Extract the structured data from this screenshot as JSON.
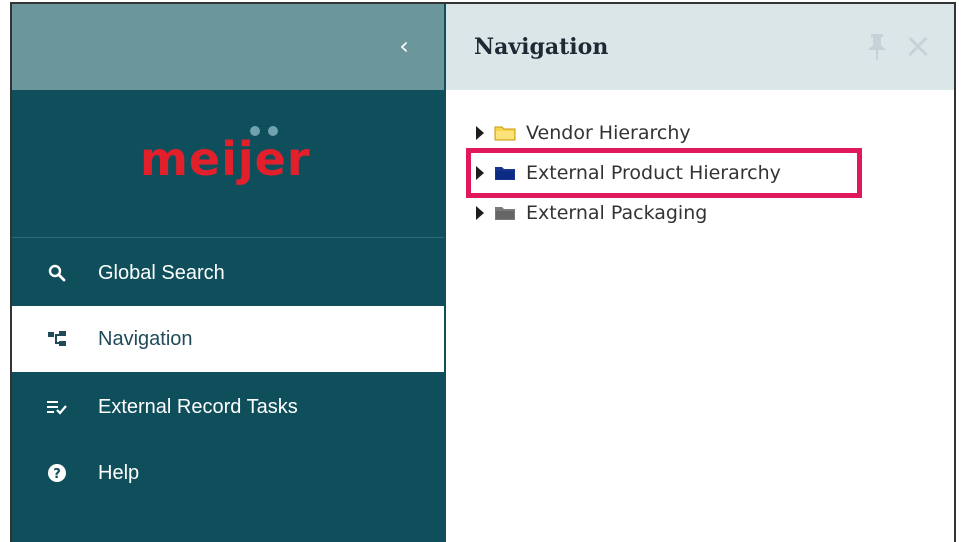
{
  "sidebar": {
    "collapse_glyph": "‹",
    "logo_text": "meijer",
    "items": [
      {
        "label": "Global Search",
        "icon": "search-icon"
      },
      {
        "label": "Navigation",
        "icon": "navigation-tree-icon",
        "active": true
      },
      {
        "label": "External Record Tasks",
        "icon": "task-list-icon"
      },
      {
        "label": "Help",
        "icon": "help-icon"
      }
    ]
  },
  "panel": {
    "title": "Navigation",
    "close_glyph": "×",
    "tree": [
      {
        "label": "Vendor Hierarchy",
        "folder_color": "#f2c318"
      },
      {
        "label": "External Product Hierarchy",
        "folder_color": "#17358f",
        "highlighted": true
      },
      {
        "label": "External Packaging",
        "folder_color": "#7a7a7a"
      }
    ]
  },
  "colors": {
    "sidebar_bg": "#0f4f5c",
    "sidebar_header_bg": "#6b969c",
    "panel_header_bg": "#dbe6e9",
    "logo_red": "#e2202c",
    "highlight": "#e0195d"
  }
}
